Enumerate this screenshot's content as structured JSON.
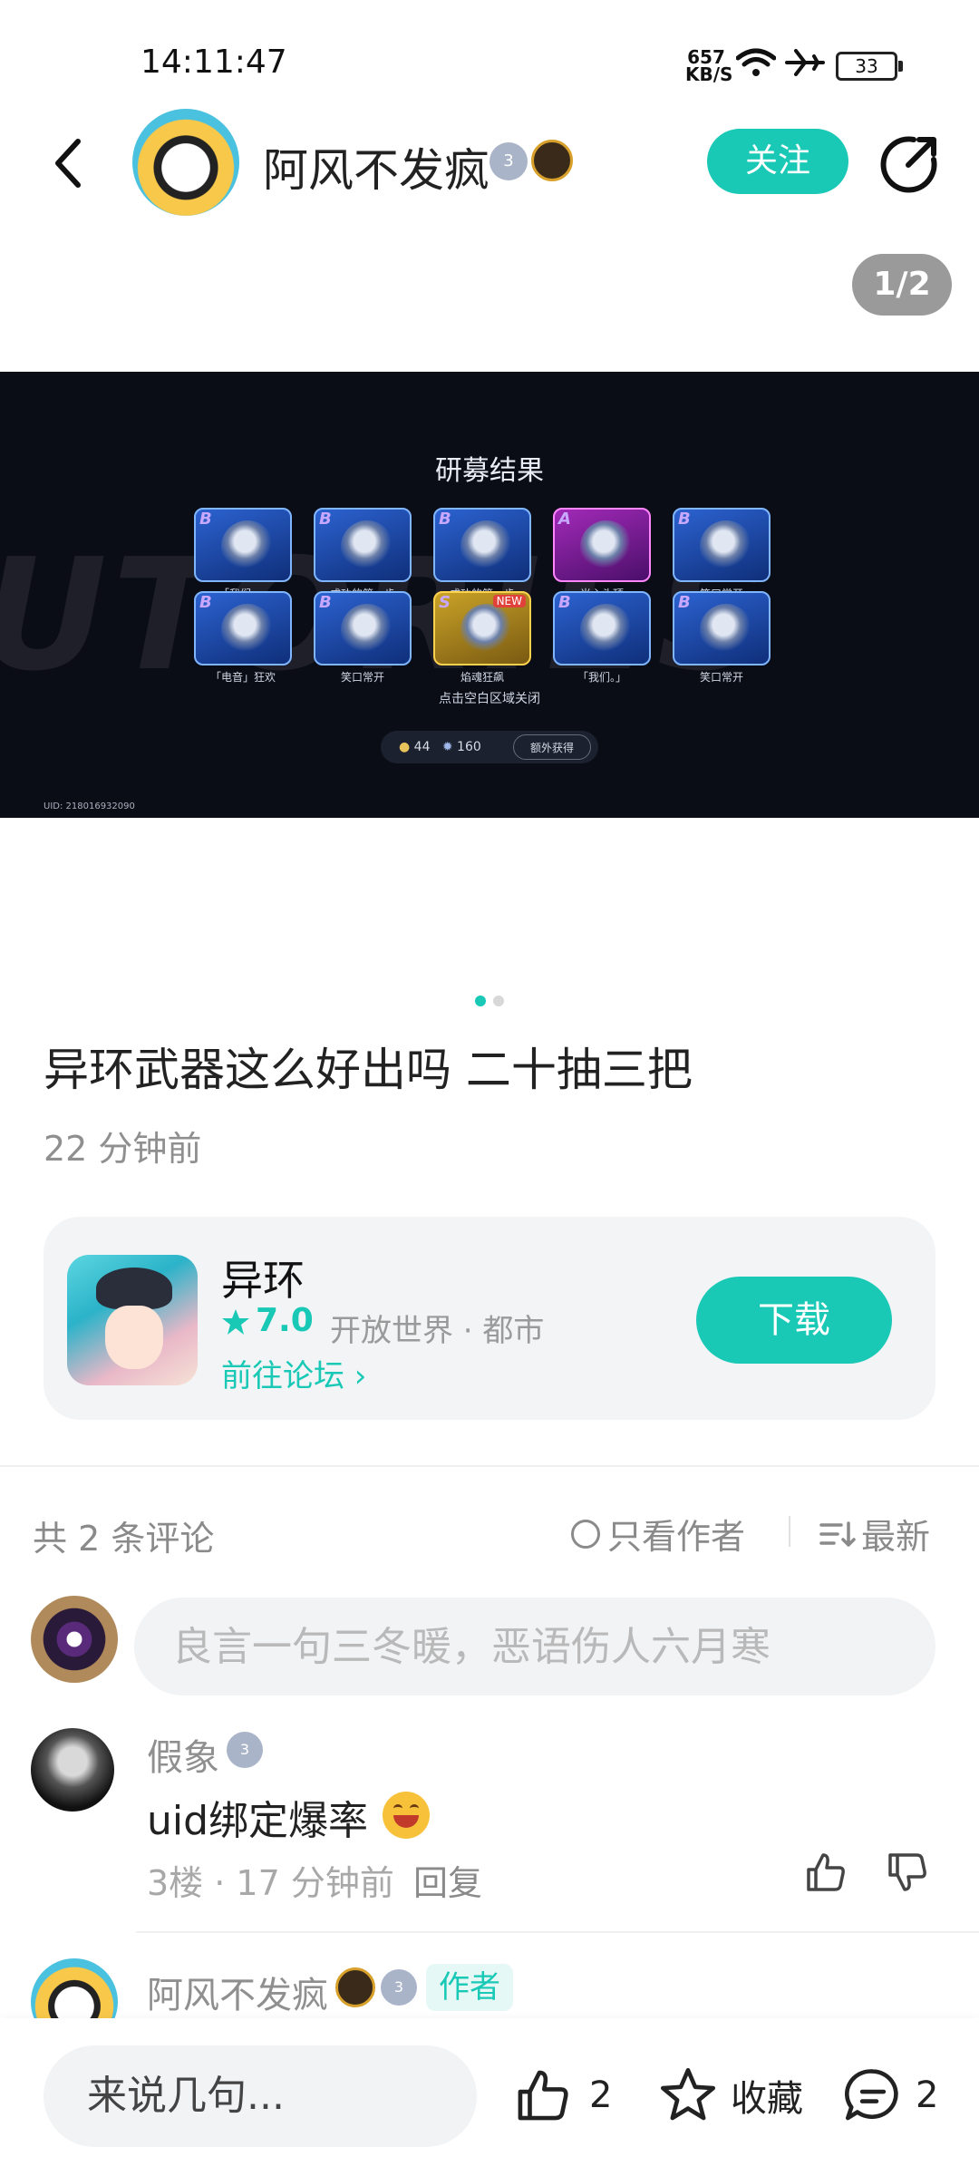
{
  "status_bar": {
    "time": "14:11:47",
    "speed": "657\nKB/S",
    "battery": "33"
  },
  "header": {
    "author_name": "阿风不发疯",
    "level_badge": "3",
    "follow_label": "关注"
  },
  "image_counter": "1/2",
  "post_image": {
    "title": "研募结果",
    "cards": [
      {
        "rank": "B",
        "name": "「我们。」",
        "tier": "b"
      },
      {
        "rank": "B",
        "name": "成功的第一步",
        "tier": "b"
      },
      {
        "rank": "B",
        "name": "成功的第一步",
        "tier": "b"
      },
      {
        "rank": "A",
        "name": "当心头顶",
        "tier": "a"
      },
      {
        "rank": "B",
        "name": "笑口常开",
        "tier": "b"
      },
      {
        "rank": "B",
        "name": "「电音」狂欢",
        "tier": "b"
      },
      {
        "rank": "B",
        "name": "笑口常开",
        "tier": "b"
      },
      {
        "rank": "S",
        "name": "焰魂狂飙",
        "tier": "s",
        "new": "NEW"
      },
      {
        "rank": "B",
        "name": "「我们。」",
        "tier": "b"
      },
      {
        "rank": "B",
        "name": "笑口常开",
        "tier": "b"
      }
    ],
    "close_hint": "点击空白区域关闭",
    "currency_a": "44",
    "currency_b": "160",
    "extra_label": "额外获得",
    "uid": "UID: 218016932090"
  },
  "post": {
    "title": "异环武器这么好出吗 二十抽三把",
    "time": "22 分钟前"
  },
  "game_card": {
    "name": "异环",
    "rating": "7.0",
    "tags": "开放世界 · 都市",
    "forum_link": "前往论坛 ›",
    "download_label": "下载"
  },
  "comments_header": {
    "count": "共 2 条评论",
    "author_only": "只看作者",
    "sort": "最新"
  },
  "comment_input": {
    "placeholder": "良言一句三冬暖，恶语伤人六月寒"
  },
  "comments": [
    {
      "name": "假象",
      "level": "3",
      "text": "uid绑定爆率",
      "meta": "3楼 · 17 分钟前",
      "reply": "回复"
    },
    {
      "name": "阿风不发疯",
      "level": "3",
      "tag": "作者"
    }
  ],
  "bottom_bar": {
    "input_placeholder": "来说几句...",
    "like_count": "2",
    "favorite_label": "收藏",
    "comment_count": "2"
  },
  "colors": {
    "accent": "#19c9b6"
  }
}
